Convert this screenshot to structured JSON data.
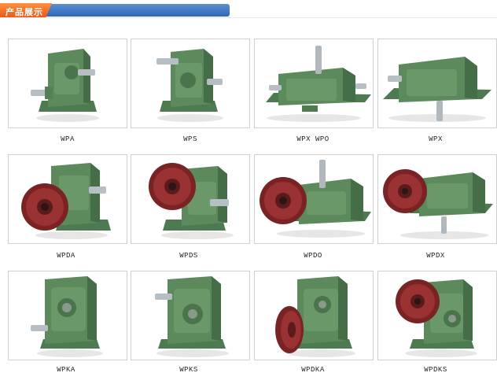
{
  "header": {
    "title": "产品展示"
  },
  "products": [
    {
      "name": "WPA",
      "image_kind": "wpa"
    },
    {
      "name": "WPS",
      "image_kind": "wps"
    },
    {
      "name": "WPX WPO",
      "image_kind": "wpx-wide"
    },
    {
      "name": "WPX",
      "image_kind": "wpx"
    },
    {
      "name": "WPDA",
      "image_kind": "flange-left"
    },
    {
      "name": "WPDS",
      "image_kind": "flange-left-up"
    },
    {
      "name": "WPDO",
      "image_kind": "flange-wide"
    },
    {
      "name": "WPDX",
      "image_kind": "flange-wide2"
    },
    {
      "name": "WPKA",
      "image_kind": "ka"
    },
    {
      "name": "WPKS",
      "image_kind": "ks"
    },
    {
      "name": "WPDKA",
      "image_kind": "dka"
    },
    {
      "name": "WPDKS",
      "image_kind": "dks"
    }
  ]
}
